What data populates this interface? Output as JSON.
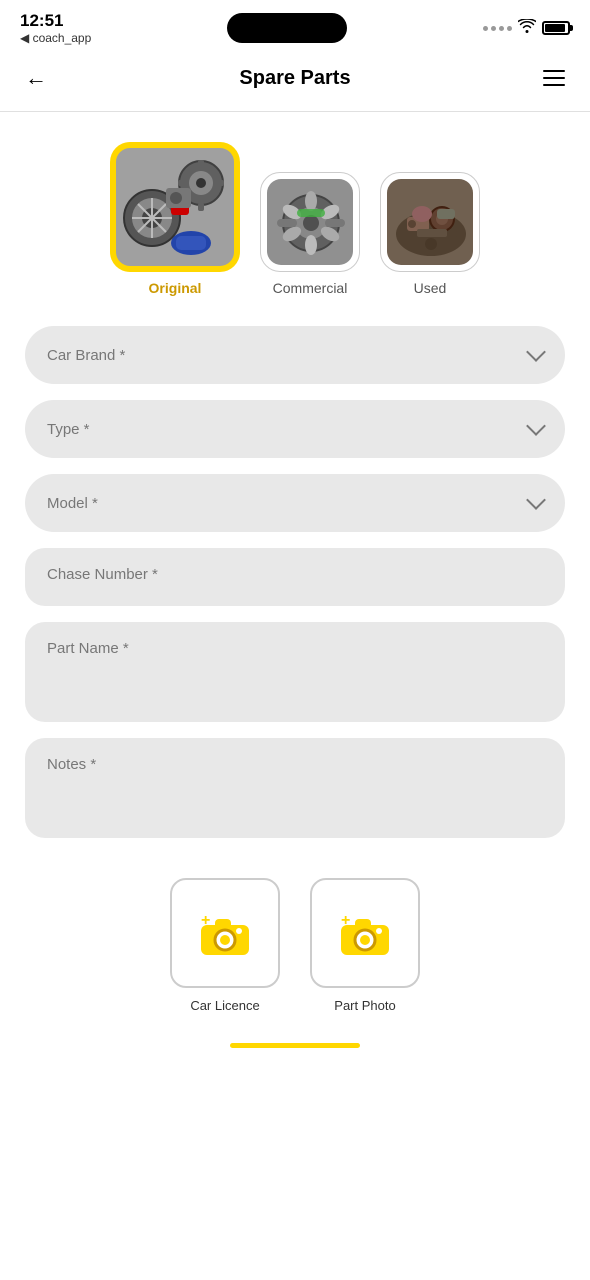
{
  "status": {
    "time": "12:51",
    "app_name": "◀ coach_app"
  },
  "header": {
    "back_label": "←",
    "title": "Spare Parts",
    "menu_label": "☰"
  },
  "categories": [
    {
      "id": "original",
      "label": "Original",
      "active": true,
      "size": "large"
    },
    {
      "id": "commercial",
      "label": "Commercial",
      "active": false,
      "size": "small"
    },
    {
      "id": "used",
      "label": "Used",
      "active": false,
      "size": "small"
    }
  ],
  "form": {
    "fields": [
      {
        "id": "car-brand",
        "label": "Car Brand *",
        "type": "dropdown"
      },
      {
        "id": "type",
        "label": "Type *",
        "type": "dropdown"
      },
      {
        "id": "model",
        "label": "Model *",
        "type": "dropdown"
      },
      {
        "id": "chase-number",
        "label": "Chase Number *",
        "type": "input"
      },
      {
        "id": "part-name",
        "label": "Part Name *",
        "type": "textarea"
      },
      {
        "id": "notes",
        "label": "Notes *",
        "type": "textarea"
      }
    ]
  },
  "photo_buttons": [
    {
      "id": "car-licence",
      "label": "Car Licence"
    },
    {
      "id": "part-photo",
      "label": "Part Photo"
    }
  ]
}
